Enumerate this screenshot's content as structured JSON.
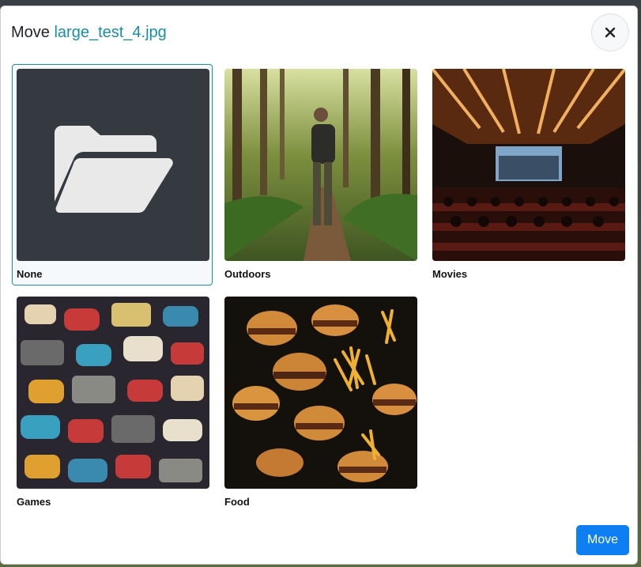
{
  "dialog": {
    "title_prefix": "Move",
    "file_name": "large_test_4.jpg",
    "close_icon": "close-icon",
    "move_label": "Move"
  },
  "folders": [
    {
      "label": "None",
      "selected": true,
      "icon": "folder-open-icon"
    },
    {
      "label": "Outdoors",
      "selected": false
    },
    {
      "label": "Movies",
      "selected": false
    },
    {
      "label": "Games",
      "selected": false
    },
    {
      "label": "Food",
      "selected": false
    }
  ],
  "colors": {
    "accent": "#1a8fa8",
    "primary_button": "#0d7ff2",
    "folder_tile_bg": "#343a40"
  }
}
